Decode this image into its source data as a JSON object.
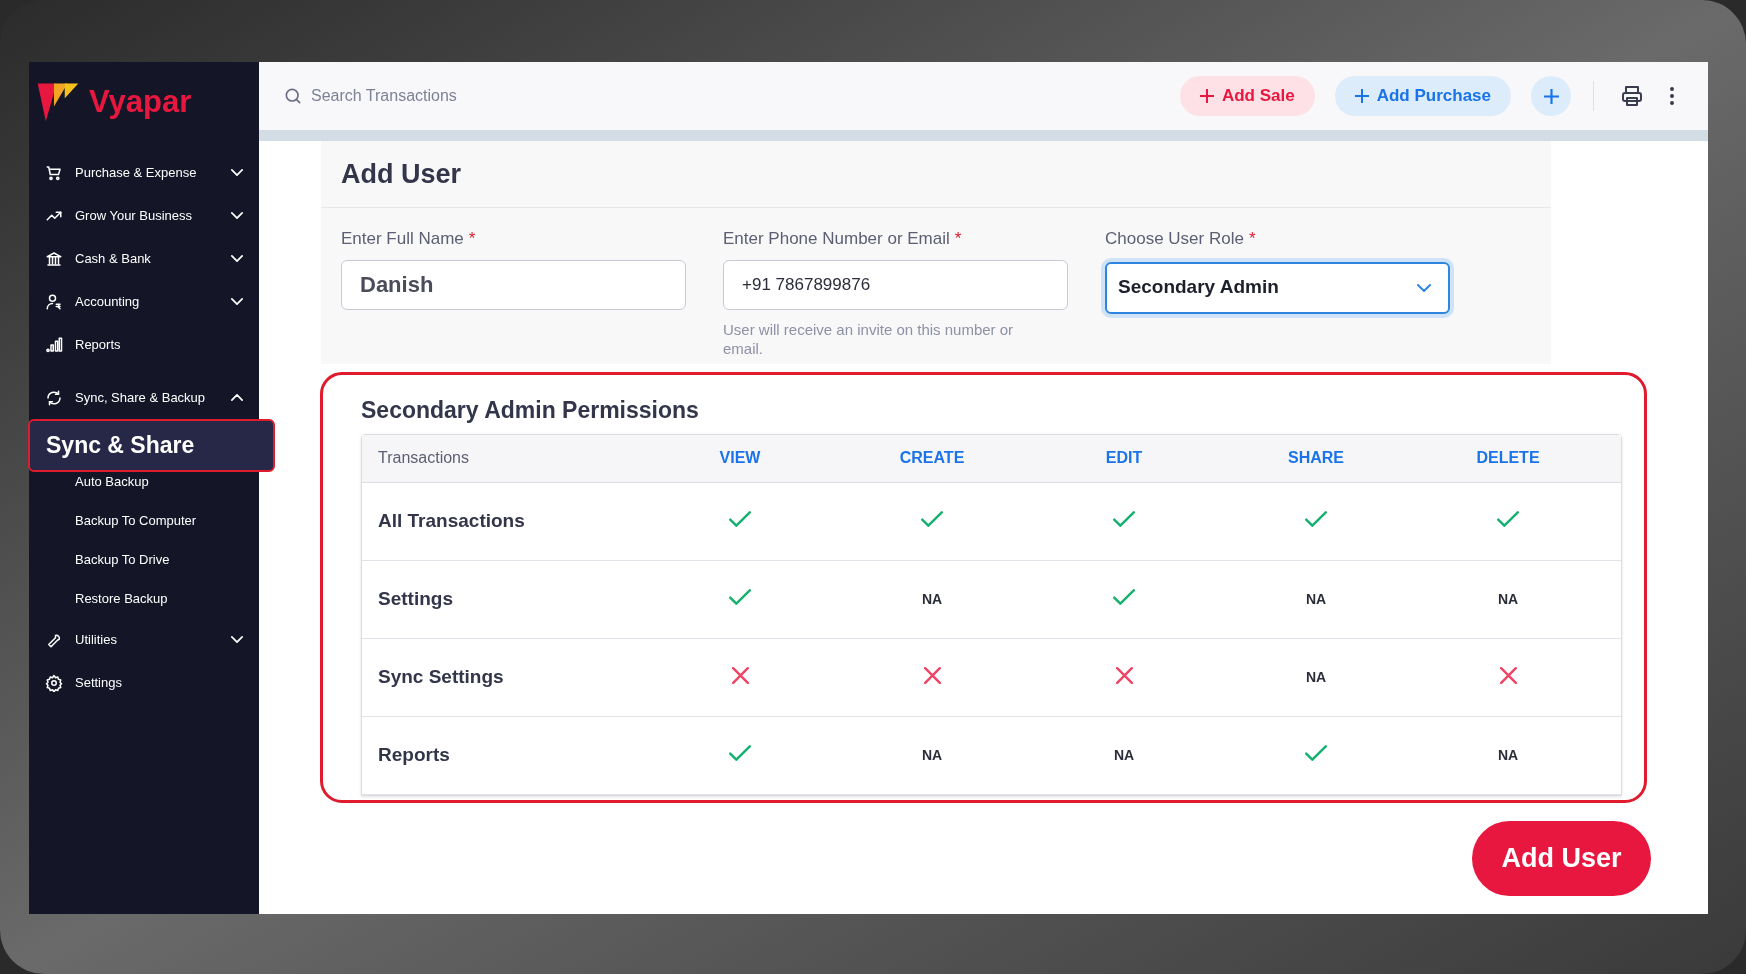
{
  "brand": {
    "name": "Vyapar"
  },
  "sidebar": {
    "items": [
      {
        "label": "Purchase & Expense",
        "expanded": false
      },
      {
        "label": "Grow Your Business",
        "expanded": false
      },
      {
        "label": "Cash & Bank",
        "expanded": false
      },
      {
        "label": "Accounting",
        "expanded": false
      },
      {
        "label": "Reports"
      },
      {
        "label": "Sync, Share & Backup",
        "expanded": true,
        "children": [
          {
            "label": "Sync & Share",
            "selected": true
          },
          {
            "label": "Auto Backup",
            "selected": false
          },
          {
            "label": "Backup To Computer",
            "selected": false
          },
          {
            "label": "Backup To Drive",
            "selected": false
          },
          {
            "label": "Restore Backup",
            "selected": false
          }
        ]
      },
      {
        "label": "Utilities",
        "expanded": false
      },
      {
        "label": "Settings"
      }
    ]
  },
  "topbar": {
    "search": {
      "placeholder": "Search Transactions"
    },
    "add_sale": "Add Sale",
    "add_purchase": "Add Purchase"
  },
  "form": {
    "title": "Add User",
    "fields": [
      {
        "label": "Enter Full Name",
        "required_mark": "*",
        "kind": "text",
        "value": "Danish"
      },
      {
        "label": "Enter Phone Number or Email",
        "required_mark": "*",
        "kind": "text",
        "value": "+91 7867899876",
        "hint": "User will receive an invite on this number or email."
      },
      {
        "label": "Choose User Role",
        "required_mark": "*",
        "kind": "select",
        "value": "Secondary Admin"
      }
    ]
  },
  "permissions": {
    "title": "Secondary Admin Permissions",
    "columns": [
      "Transactions",
      "VIEW",
      "CREATE",
      "EDIT",
      "SHARE",
      "DELETE"
    ],
    "rows": [
      {
        "cells": [
          {
            "kind": "label",
            "text": "All Transactions"
          },
          {
            "kind": "check"
          },
          {
            "kind": "check"
          },
          {
            "kind": "check"
          },
          {
            "kind": "check"
          },
          {
            "kind": "check"
          }
        ]
      },
      {
        "cells": [
          {
            "kind": "label",
            "text": "Settings"
          },
          {
            "kind": "check"
          },
          {
            "kind": "na",
            "text": "NA"
          },
          {
            "kind": "check"
          },
          {
            "kind": "na",
            "text": "NA"
          },
          {
            "kind": "na",
            "text": "NA"
          }
        ]
      },
      {
        "cells": [
          {
            "kind": "label",
            "text": "Sync Settings"
          },
          {
            "kind": "cross"
          },
          {
            "kind": "cross"
          },
          {
            "kind": "cross"
          },
          {
            "kind": "na",
            "text": "NA"
          },
          {
            "kind": "cross"
          }
        ]
      },
      {
        "cells": [
          {
            "kind": "label",
            "text": "Reports"
          },
          {
            "kind": "check"
          },
          {
            "kind": "na",
            "text": "NA"
          },
          {
            "kind": "na",
            "text": "NA"
          },
          {
            "kind": "check"
          },
          {
            "kind": "na",
            "text": "NA"
          }
        ]
      }
    ]
  },
  "submit": "Add User"
}
